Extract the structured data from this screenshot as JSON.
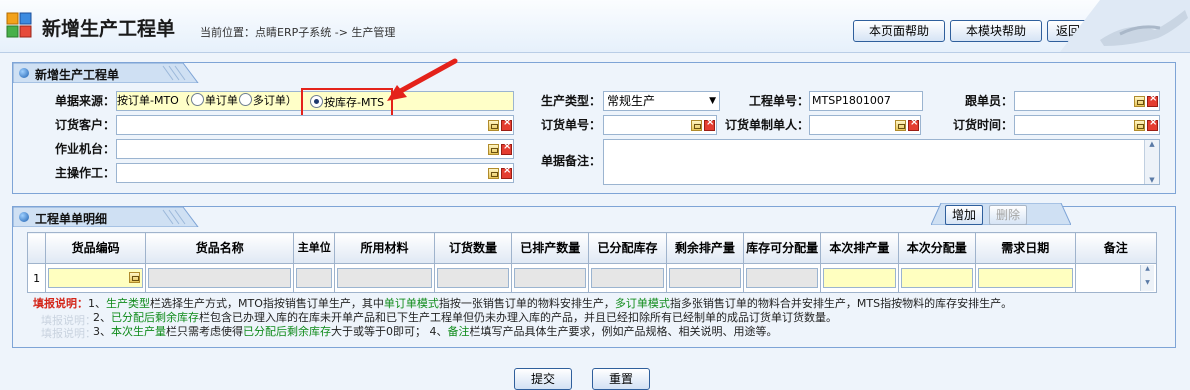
{
  "header": {
    "title": "新增生产工程单",
    "breadcrumb": "当前位置：点睛ERP子系统 -> 生产管理",
    "buttons": {
      "page_help": "本页面帮助",
      "module_help": "本模块帮助",
      "back": "返回"
    }
  },
  "form": {
    "panel_title": "新增生产工程单",
    "source_label": "单据来源：",
    "source_prefix": "按订单-MTO（",
    "radio_single": "单订单",
    "radio_multi": "多订单）",
    "radio_stock": "按库存-MTS",
    "customer_label": "订货客户：",
    "machine_label": "作业机台：",
    "operator_label": "主操作工：",
    "prod_type_label": "生产类型：",
    "prod_type_value": "常规生产",
    "order_no_label": "订货单号：",
    "remark_label": "单据备注：",
    "eng_no_label": "工程单号：",
    "eng_no_value": "MTSP1801007",
    "order_maker_label": "订货单制单人：",
    "follower_label": "跟单员：",
    "order_time_label": "订货时间："
  },
  "detail": {
    "panel_title": "工程单单明细",
    "add_button": "增加",
    "delete_button": "删除",
    "columns": [
      "货品编码",
      "货品名称",
      "主单位",
      "所用材料",
      "订货数量",
      "已排产数量",
      "已分配库存",
      "剩余排产量",
      "库存可分配量",
      "本次排产量",
      "本次分配量",
      "需求日期",
      "备注"
    ],
    "row_number": "1"
  },
  "notes": {
    "label": "填报说明：",
    "line1": [
      {
        "t": "1、",
        "c": ""
      },
      {
        "t": "生产类型",
        "c": "g"
      },
      {
        "t": "栏选择生产方式，MTO指按销售订单生产，其中",
        "c": ""
      },
      {
        "t": "单订单模式",
        "c": "g"
      },
      {
        "t": "指按一张销售订单的物料安排生产，",
        "c": ""
      },
      {
        "t": "多订单模式",
        "c": "g"
      },
      {
        "t": "指多张销售订单的物料合并安排生产，MTS指按物料的库存安排生产。",
        "c": ""
      }
    ],
    "line2": [
      {
        "t": "2、",
        "c": ""
      },
      {
        "t": "已分配后剩余库存",
        "c": "g"
      },
      {
        "t": "栏包含已办理入库的在库未开单产品和已下生产工程单但仍未办理入库的产品，并且已经扣除所有已经制单的成品订货单订货数量。",
        "c": ""
      }
    ],
    "line3": [
      {
        "t": "3、",
        "c": ""
      },
      {
        "t": "本次生产量",
        "c": "g"
      },
      {
        "t": "栏只需考虑使得",
        "c": ""
      },
      {
        "t": "已分配后剩余库存",
        "c": "g"
      },
      {
        "t": "大于或等于0即可；  4、",
        "c": ""
      },
      {
        "t": "备注",
        "c": "g"
      },
      {
        "t": "栏填写产品具体生产要求，例如产品规格、相关说明、用途等。",
        "c": ""
      }
    ],
    "ghost1": "填报说明：",
    "ghost2": "填报说明："
  },
  "footer": {
    "submit": "提交",
    "reset": "重置"
  }
}
